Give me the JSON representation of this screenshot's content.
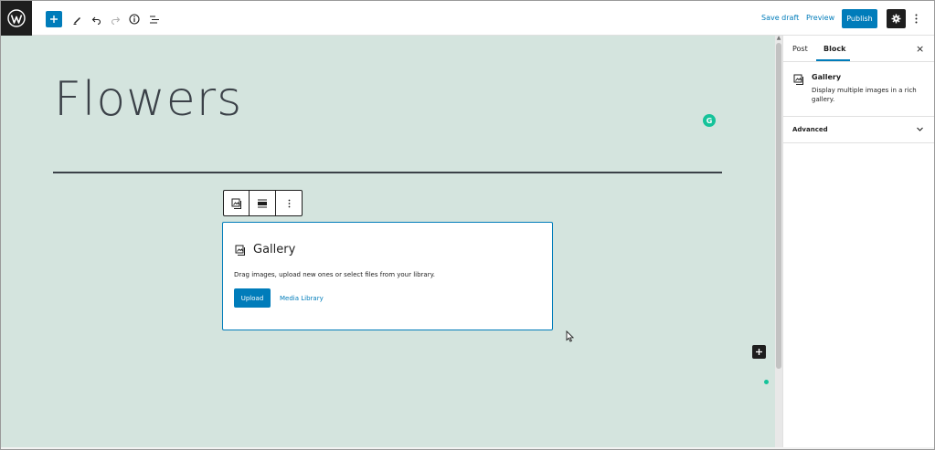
{
  "topbar": {
    "save_draft": "Save draft",
    "preview": "Preview",
    "publish": "Publish"
  },
  "editor": {
    "post_title": "Flowers",
    "grammarly_badge": "G",
    "block_toolbar": [
      "gallery-block-icon",
      "align-icon",
      "more-options-icon"
    ],
    "gallery": {
      "title": "Gallery",
      "description": "Drag images, upload new ones or select files from your library.",
      "upload_label": "Upload",
      "media_library_label": "Media Library"
    }
  },
  "sidebar": {
    "tabs": [
      {
        "label": "Post",
        "active": false
      },
      {
        "label": "Block",
        "active": true
      }
    ],
    "close_label": "×",
    "block_card": {
      "name": "Gallery",
      "description": "Display multiple images in a rich gallery."
    },
    "advanced_label": "Advanced"
  },
  "colors": {
    "accent": "#007cba",
    "canvas_bg": "#d4e4de",
    "dark": "#1e1e1e",
    "grammarly": "#15c39a"
  }
}
